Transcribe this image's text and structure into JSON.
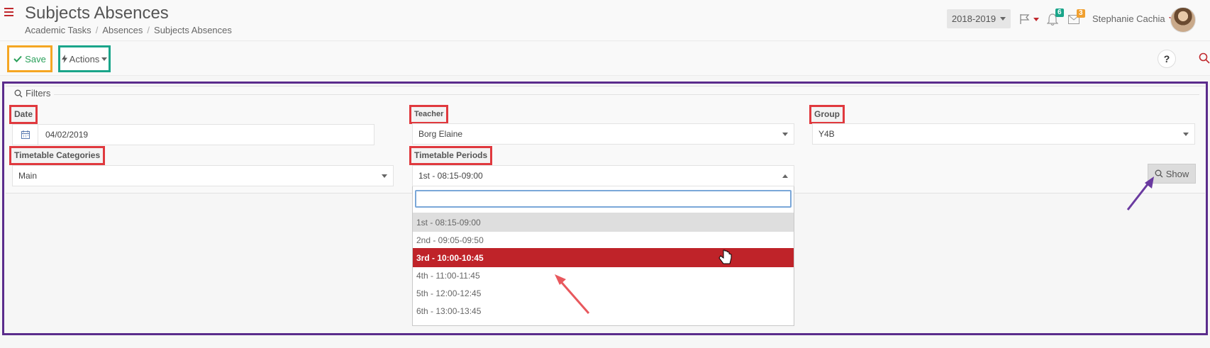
{
  "header": {
    "title": "Subjects Absences",
    "breadcrumb": [
      "Academic Tasks",
      "Absences",
      "Subjects Absences"
    ],
    "year": "2018-2019",
    "notifications_count": "6",
    "messages_count": "3",
    "user_name": "Stephanie Cachia"
  },
  "toolbar": {
    "save_label": "Save",
    "actions_label": "Actions",
    "help_label": "?"
  },
  "filters": {
    "legend": "Filters",
    "date": {
      "label": "Date",
      "value": "04/02/2019"
    },
    "teacher": {
      "label": "Teacher",
      "value": "Borg Elaine"
    },
    "group": {
      "label": "Group",
      "value": "Y4B"
    },
    "timetable_categories": {
      "label": "Timetable Categories",
      "value": "Main"
    },
    "timetable_periods": {
      "label": "Timetable Periods",
      "value": "1st - 08:15-09:00",
      "search_placeholder": "",
      "options": [
        "1st - 08:15-09:00",
        "2nd - 09:05-09:50",
        "3rd - 10:00-10:45",
        "4th - 11:00-11:45",
        "5th - 12:00-12:45",
        "6th - 13:00-13:45"
      ],
      "selected_index": 0,
      "hovered_index": 2
    },
    "show_label": "Show"
  },
  "colors": {
    "accent_red": "#bf2329",
    "save_highlight": "#f5a623",
    "actions_highlight": "#1aa58a",
    "main_frame": "#5b2c8c",
    "label_highlight": "#e0393e"
  }
}
